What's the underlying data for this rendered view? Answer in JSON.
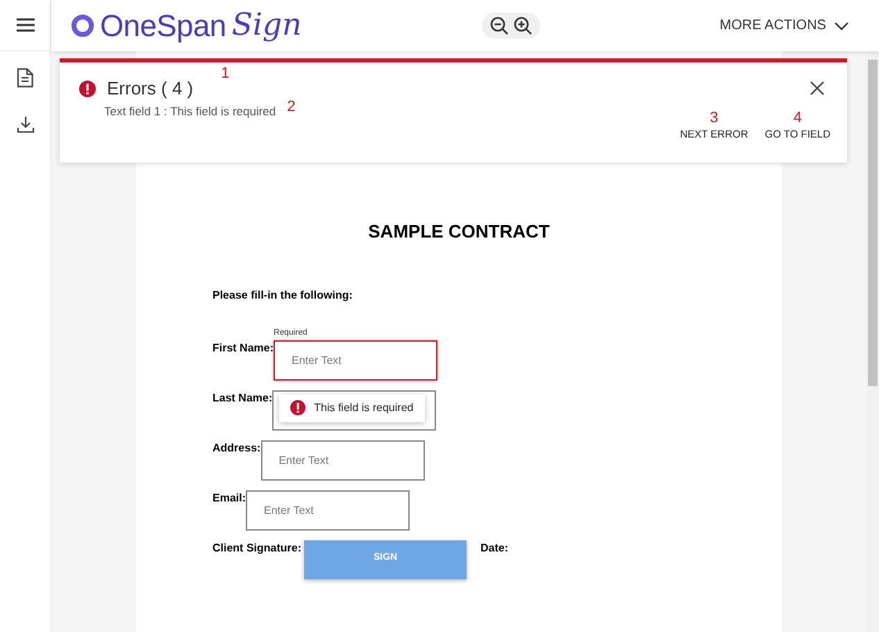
{
  "header": {
    "logo": {
      "name": "OneSpan",
      "script": "Sign"
    },
    "more_actions": "MORE ACTIONS"
  },
  "error_panel": {
    "title": "Errors ( 4 )",
    "message": "Text field 1 : This field is required",
    "actions": [
      "NEXT ERROR",
      "GO TO FIELD"
    ]
  },
  "annotations": [
    "1",
    "2",
    "3",
    "4"
  ],
  "document": {
    "title": "SAMPLE CONTRACT",
    "instruction": "Please fill-in the following:",
    "fields": [
      {
        "label": "First Name:",
        "hint": "Required",
        "placeholder": "Enter Text",
        "invalid": true
      },
      {
        "label": "Last Name:",
        "tooltip": "This field is required",
        "invalid": false
      },
      {
        "label": "Address:",
        "placeholder": "Enter Text",
        "invalid": false
      },
      {
        "label": "Email:",
        "placeholder": "Enter Text",
        "invalid": false
      }
    ],
    "signature": {
      "label": "Client Signature:",
      "button": "SIGN",
      "date_label": "Date:"
    }
  }
}
